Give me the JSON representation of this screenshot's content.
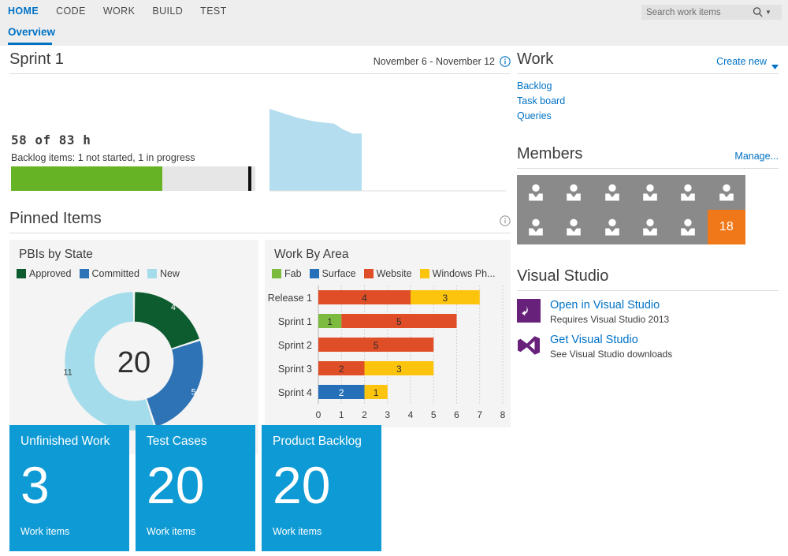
{
  "nav": {
    "items": [
      {
        "label": "HOME",
        "active": true
      },
      {
        "label": "CODE",
        "active": false
      },
      {
        "label": "WORK",
        "active": false
      },
      {
        "label": "BUILD",
        "active": false
      },
      {
        "label": "TEST",
        "active": false
      }
    ]
  },
  "search": {
    "placeholder": "Search work items",
    "value": ""
  },
  "subtab": {
    "label": "Overview"
  },
  "sprint": {
    "title": "Sprint 1",
    "date_range": "November 6 - November 12",
    "hours": "58 of 83 h",
    "hours_done": 58,
    "hours_total": 83,
    "backlog_summary": "Backlog items: 1 not started, 1 in progress",
    "progress_percent": 62,
    "marker_percent": 97
  },
  "work": {
    "title": "Work",
    "create_new_label": "Create new",
    "links": [
      "Backlog",
      "Task board",
      "Queries"
    ]
  },
  "pinned": {
    "title": "Pinned Items"
  },
  "members": {
    "title": "Members",
    "manage_label": "Manage...",
    "avatar_count": 11,
    "overflow_count": "18"
  },
  "visual_studio": {
    "title": "Visual Studio",
    "rows": [
      {
        "title": "Open in Visual Studio",
        "subtitle": "Requires Visual Studio 2013",
        "icon": "open-in-vs-icon"
      },
      {
        "title": "Get Visual Studio",
        "subtitle": "See Visual Studio downloads",
        "icon": "visual-studio-logo-icon"
      }
    ]
  },
  "count_tiles": [
    {
      "title": "Unfinished Work",
      "value": "3",
      "unit": "Work items"
    },
    {
      "title": "Test Cases",
      "value": "20",
      "unit": "Work items"
    },
    {
      "title": "Product Backlog",
      "value": "20",
      "unit": "Work items"
    }
  ],
  "colors": {
    "accent_blue": "#0072c6",
    "tile_blue": "#0e9ad4",
    "progress_green": "#67b326",
    "overflow_orange": "#f07818",
    "avatar_gray": "#8a8a8a",
    "panel_gray": "#f4f4f4",
    "vs_purple": "#68217a"
  },
  "chart_data": [
    {
      "type": "area",
      "name": "sprint-burndown",
      "title": "",
      "xlabel": "",
      "ylabel": "",
      "grid": false,
      "legend": "none",
      "x": [
        0,
        1,
        2,
        3,
        4,
        5,
        6,
        7,
        8,
        9,
        10
      ],
      "values": [
        83,
        80,
        77,
        74,
        72,
        70,
        69,
        68,
        62,
        58,
        58
      ],
      "ylim": [
        0,
        83
      ],
      "series_color": "#b4ddef"
    },
    {
      "type": "pie",
      "name": "pbis-by-state",
      "title": "PBIs by State",
      "center_label": "20",
      "total": 20,
      "legend": "top",
      "labels": [
        "Approved",
        "Committed",
        "New"
      ],
      "values": [
        4,
        5,
        11
      ],
      "colors": [
        "#0c5c30",
        "#2e73b5",
        "#a5dceb"
      ]
    },
    {
      "type": "bar",
      "name": "work-by-area",
      "title": "Work By Area",
      "orientation": "horizontal",
      "stacked": true,
      "legend": "top",
      "grid": true,
      "categories": [
        "Release 1",
        "Sprint 1",
        "Sprint 2",
        "Sprint 3",
        "Sprint 4"
      ],
      "series": [
        {
          "name": "Fab",
          "color": "#7cbb3f",
          "values": [
            0,
            1,
            0,
            0,
            0
          ]
        },
        {
          "name": "Surface",
          "color": "#2570b8",
          "values": [
            0,
            0,
            0,
            0,
            2
          ]
        },
        {
          "name": "Website",
          "color": "#df4e27",
          "values": [
            4,
            5,
            5,
            2,
            0
          ]
        },
        {
          "name": "Windows Ph...",
          "color": "#fdc40d",
          "values": [
            3,
            0,
            0,
            3,
            1
          ]
        }
      ],
      "xlim": [
        0,
        8
      ],
      "xticks": [
        0,
        1,
        2,
        3,
        4,
        5,
        6,
        7,
        8
      ],
      "xlabel": "",
      "ylabel": ""
    }
  ]
}
